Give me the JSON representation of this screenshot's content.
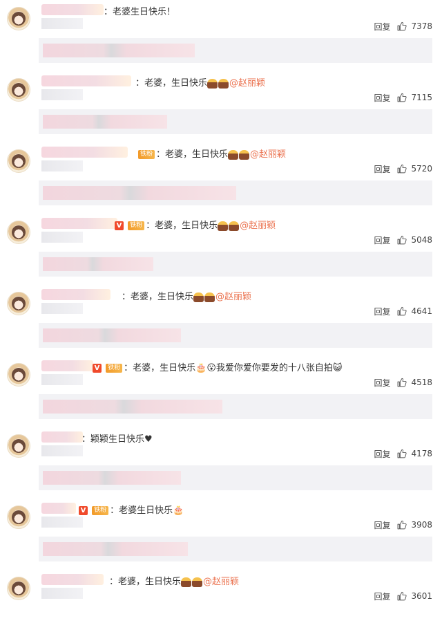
{
  "ui": {
    "reply_label": "回复"
  },
  "comments": [
    {
      "text": "：老婆生日快乐！",
      "mention": "",
      "likes": "7378",
      "vip": false,
      "fan": false,
      "cakes": 0
    },
    {
      "text": "：老婆，生日快乐",
      "mention": "@赵丽颖",
      "likes": "7115",
      "vip": false,
      "fan": false,
      "cakes": 2
    },
    {
      "text": "：老婆，生日快乐",
      "mention": "@赵丽颖",
      "likes": "5720",
      "vip": false,
      "fan": true,
      "cakes": 2,
      "fan_label": "铁粉"
    },
    {
      "text": "：老婆，生日快乐",
      "mention": "@赵丽颖",
      "likes": "5048",
      "vip": true,
      "fan": true,
      "cakes": 2,
      "fan_label": "铁粉",
      "vip_label": "V"
    },
    {
      "text": "：老婆，生日快乐",
      "mention": "@赵丽颖",
      "likes": "4641",
      "vip": false,
      "fan": false,
      "cakes": 2
    },
    {
      "text": "：老婆，生日快乐🎂😮我爱你爱你要发的十八张自拍😺",
      "mention": "",
      "likes": "4518",
      "vip": true,
      "fan": true,
      "cakes": 0,
      "fan_label": "铁粉",
      "vip_label": "V"
    },
    {
      "text": "：颖颖生日快乐♥",
      "mention": "",
      "likes": "4178",
      "vip": false,
      "fan": false,
      "cakes": 0
    },
    {
      "text": "：老婆生日快乐🎂",
      "mention": "",
      "likes": "3908",
      "vip": true,
      "fan": true,
      "cakes": 0,
      "fan_label": "铁粉",
      "vip_label": "V"
    },
    {
      "text": "：老婆，生日快乐",
      "mention": "@赵丽颖",
      "likes": "3601",
      "vip": false,
      "fan": false,
      "cakes": 2
    }
  ],
  "colors": {
    "mention": "#eb7350",
    "reply_bg": "#f2f2f5",
    "vip_badge": "#f04a2b",
    "fan_badge": "#f29a29"
  }
}
